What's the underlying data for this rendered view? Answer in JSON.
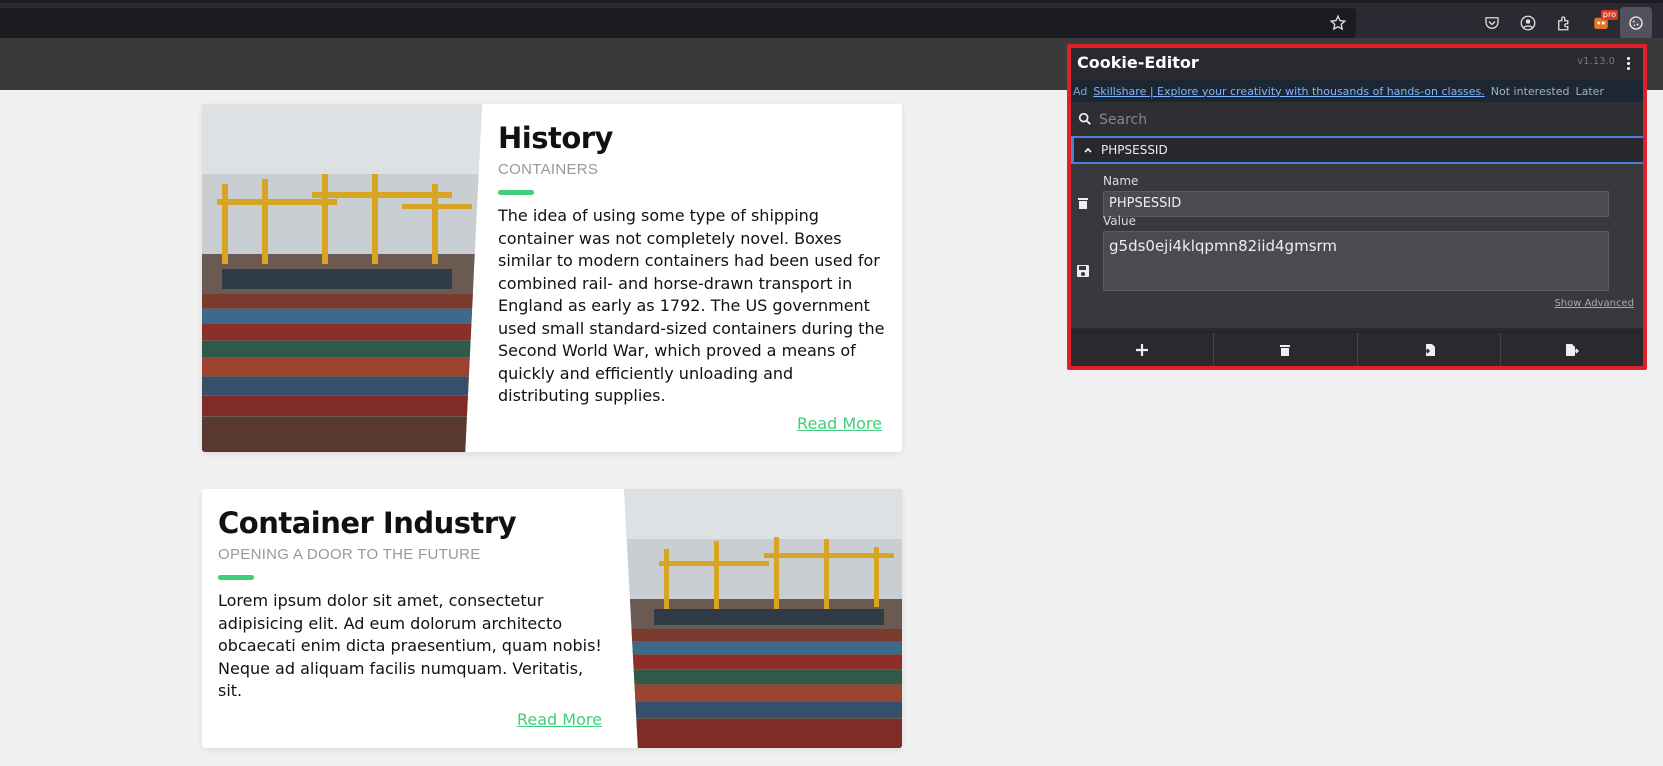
{
  "browser": {
    "icons": [
      "bookmark-star-icon",
      "pocket-icon",
      "account-icon",
      "extensions-icon",
      "pro-extension-icon",
      "cookie-editor-icon"
    ],
    "pro_badge": "pro"
  },
  "cards": [
    {
      "title": "History",
      "subtitle": "CONTAINERS",
      "body": "The idea of using some type of shipping container was not completely novel. Boxes similar to modern containers had been used for combined rail- and horse-drawn transport in England as early as 1792. The US government used small standard-sized containers during the Second World War, which proved a means of quickly and efficiently unloading and distributing supplies.",
      "link": "Read More"
    },
    {
      "title": "Container Industry",
      "subtitle": "OPENING A DOOR TO THE FUTURE",
      "body": "Lorem ipsum dolor sit amet, consectetur adipisicing elit. Ad eum dolorum architecto obcaecati enim dicta praesentium, quam nobis! Neque ad aliquam facilis numquam. Veritatis, sit.",
      "link": "Read More"
    }
  ],
  "accent_color": "#3fcf7a",
  "cookie_editor": {
    "title": "Cookie-Editor",
    "version": "v1.13.0",
    "ad": {
      "tag": "Ad",
      "text": "Skillshare | Explore your creativity with thousands of hands-on classes.",
      "not_interested": "Not interested",
      "later": "Later"
    },
    "search_placeholder": "Search",
    "cookie": {
      "header": "PHPSESSID",
      "name_label": "Name",
      "name": "PHPSESSID",
      "value_label": "Value",
      "value": "g5ds0eji4klqpmn82iid4gmsrm",
      "show_advanced": "Show Advanced"
    },
    "footer_icons": [
      "add-icon",
      "delete-all-icon",
      "import-icon",
      "export-icon"
    ],
    "highlight_color": "#e0202a"
  }
}
